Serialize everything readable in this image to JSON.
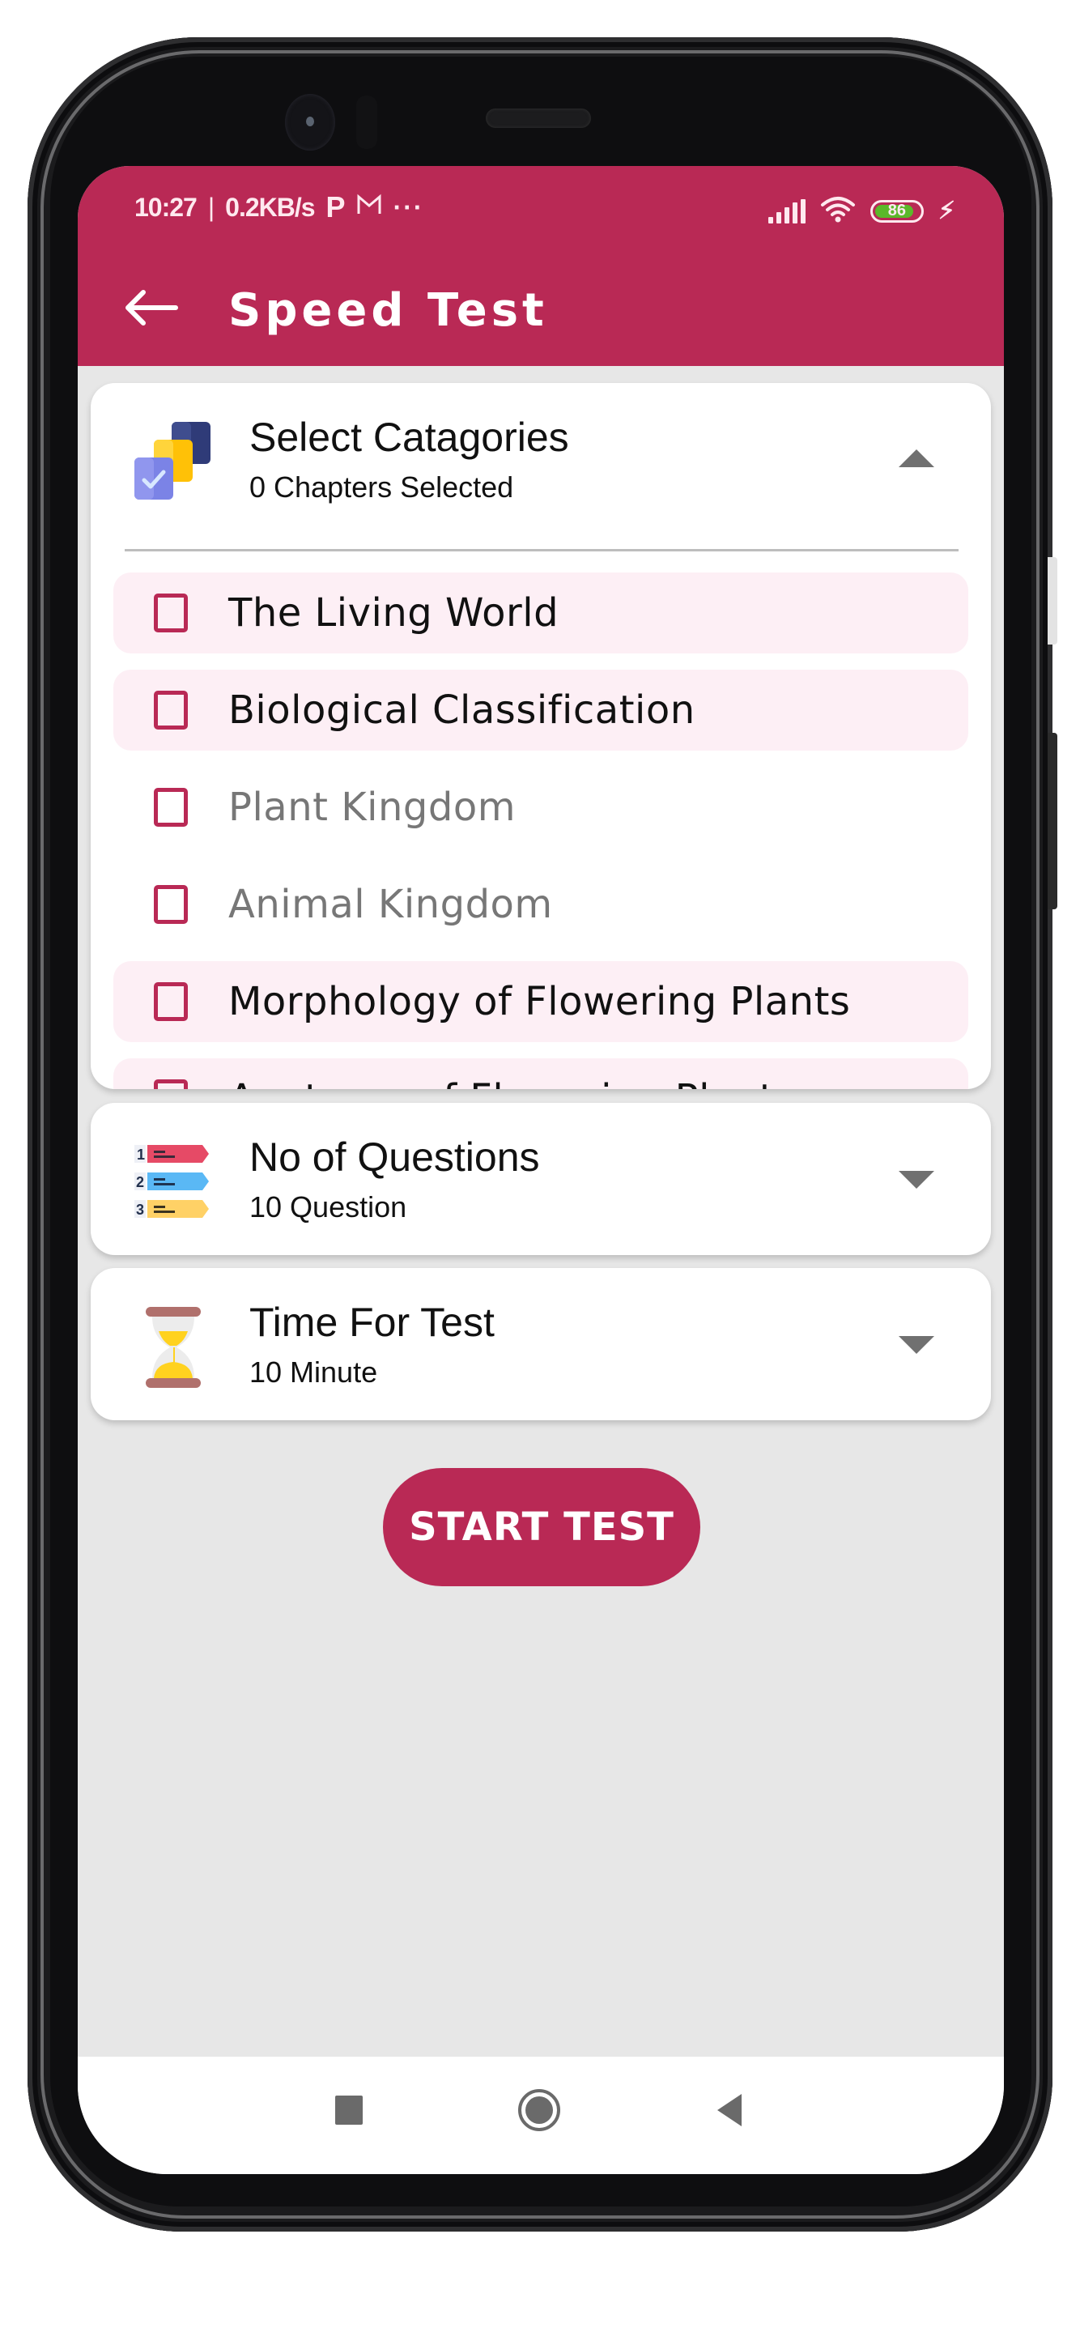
{
  "status_bar": {
    "time": "10:27",
    "network_speed": "0.2KB/s",
    "battery_level": "86",
    "notification_icons": [
      "p-icon",
      "gmail-icon",
      "more-dots-icon"
    ],
    "system_icons": [
      "signal-icon",
      "wifi-icon",
      "battery-icon",
      "charging-bolt-icon"
    ]
  },
  "header": {
    "title": "Speed Test",
    "back_icon": "arrow-left-icon"
  },
  "colors": {
    "primary": "#b92955",
    "background": "#e7e7e7",
    "card": "#ffffff",
    "highlight_row": "#fdeff5",
    "checkbox_border": "#b92955",
    "battery_fill": "#5bb82a"
  },
  "categories_card": {
    "title": "Select Catagories",
    "subtitle": "0 Chapters Selected",
    "icon": "stacked-checklist-icon",
    "expanded": true,
    "items": [
      {
        "label": "The Living World",
        "checked": false,
        "highlighted": true
      },
      {
        "label": "Biological Classification",
        "checked": false,
        "highlighted": true
      },
      {
        "label": "Plant Kingdom",
        "checked": false,
        "highlighted": false
      },
      {
        "label": "Animal Kingdom",
        "checked": false,
        "highlighted": false
      },
      {
        "label": "Morphology of Flowering Plants",
        "checked": false,
        "highlighted": true
      },
      {
        "label": "Anatomy of Flowering Plants",
        "checked": false,
        "highlighted": true
      }
    ]
  },
  "questions_card": {
    "title": "No of Questions",
    "value": "10 Question",
    "icon": "numbered-list-icon",
    "expanded": false
  },
  "time_card": {
    "title": "Time For Test",
    "value": "10 Minute",
    "icon": "hourglass-icon",
    "expanded": false
  },
  "start_button": {
    "label": "START TEST"
  },
  "nav_bar": {
    "items": [
      "recent-apps",
      "home",
      "back"
    ]
  }
}
